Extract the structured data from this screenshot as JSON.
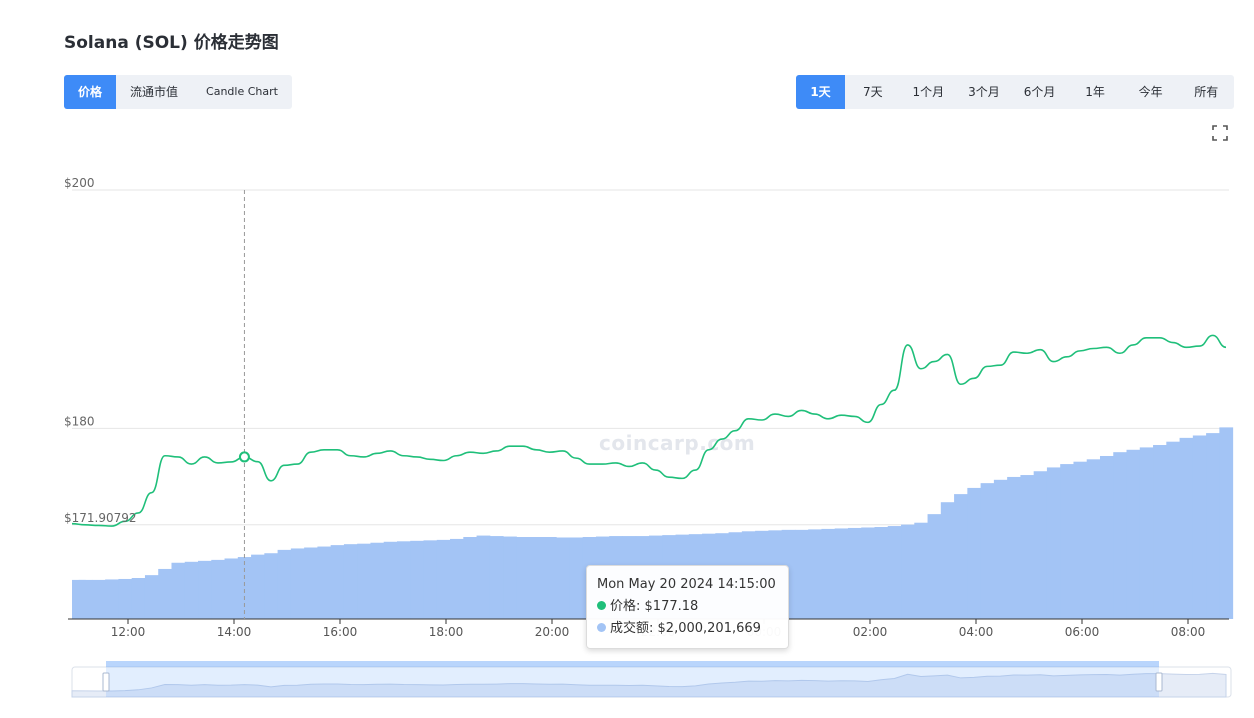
{
  "page_title": "Solana (SOL) 价格走势图",
  "metric_tabs": [
    {
      "label": "价格",
      "active": true
    },
    {
      "label": "流通市值",
      "active": false
    },
    {
      "label": "Candle Chart",
      "active": false
    }
  ],
  "range_tabs": [
    {
      "label": "1天",
      "active": true
    },
    {
      "label": "7天",
      "active": false
    },
    {
      "label": "1个月",
      "active": false
    },
    {
      "label": "3个月",
      "active": false
    },
    {
      "label": "6个月",
      "active": false
    },
    {
      "label": "1年",
      "active": false
    },
    {
      "label": "今年",
      "active": false
    },
    {
      "label": "所有",
      "active": false
    }
  ],
  "watermark": "coincarp.com",
  "tooltip": {
    "datetime": "Mon May 20 2024 14:15:00",
    "price_label": "价格:",
    "price_value": "$177.18",
    "volume_label": "成交额:",
    "volume_value": "$2,000,201,669"
  },
  "colors": {
    "price_line": "#1fbf7a",
    "volume_fill": "#a3c4f5",
    "accent": "#3e8bf7"
  },
  "chart_data": {
    "type": "line",
    "series": [
      {
        "name": "价格",
        "x": [
          "11:00",
          "11:15",
          "11:30",
          "11:45",
          "12:00",
          "12:15",
          "12:30",
          "12:45",
          "13:00",
          "13:15",
          "13:30",
          "13:45",
          "14:00",
          "14:15",
          "14:30",
          "14:45",
          "15:00",
          "15:15",
          "15:30",
          "15:45",
          "16:00",
          "16:15",
          "16:30",
          "16:45",
          "17:00",
          "17:15",
          "17:30",
          "17:45",
          "18:00",
          "18:15",
          "18:30",
          "18:45",
          "19:00",
          "19:15",
          "19:30",
          "19:45",
          "20:00",
          "20:15",
          "20:30",
          "20:45",
          "21:00",
          "21:15",
          "21:30",
          "21:45",
          "22:00",
          "22:15",
          "22:30",
          "22:45",
          "23:00",
          "23:15",
          "23:30",
          "23:45",
          "00:00",
          "00:15",
          "00:30",
          "00:45",
          "01:00",
          "01:15",
          "01:30",
          "01:45",
          "02:00",
          "02:15",
          "02:30",
          "02:45",
          "03:00",
          "03:15",
          "03:30",
          "03:45",
          "04:00",
          "04:15",
          "04:30",
          "04:45",
          "05:00",
          "05:15",
          "05:30",
          "05:45",
          "06:00",
          "06:15",
          "06:30",
          "06:45",
          "07:00",
          "07:15",
          "07:30",
          "07:45",
          "08:00",
          "08:15",
          "08:30",
          "08:45"
        ],
        "values": [
          172.0,
          171.9,
          171.85,
          171.8,
          172.2,
          172.9,
          174.6,
          177.7,
          177.6,
          177.0,
          177.6,
          177.1,
          177.18,
          177.6,
          177.2,
          175.6,
          176.9,
          177.0,
          178.0,
          178.2,
          178.2,
          177.7,
          177.6,
          177.9,
          178.1,
          177.7,
          177.6,
          177.4,
          177.3,
          177.7,
          178.0,
          177.9,
          178.1,
          178.5,
          178.5,
          178.2,
          178.0,
          178.1,
          177.5,
          177.0,
          177.0,
          177.1,
          176.8,
          177.1,
          176.5,
          175.9,
          175.8,
          176.5,
          178.2,
          179.1,
          179.8,
          180.8,
          180.7,
          181.2,
          181.0,
          181.5,
          181.2,
          180.8,
          181.1,
          181.0,
          180.5,
          182.0,
          183.2,
          187.0,
          185.0,
          185.6,
          186.2,
          183.7,
          184.2,
          185.2,
          185.3,
          186.4,
          186.3,
          186.6,
          185.6,
          186.0,
          186.5,
          186.7,
          186.8,
          186.3,
          187.0,
          187.6,
          187.6,
          187.2,
          186.8,
          186.9,
          187.8,
          186.8
        ]
      },
      {
        "name": "成交额",
        "values": [
          0.82,
          0.82,
          0.82,
          0.83,
          0.84,
          0.86,
          0.92,
          1.05,
          1.18,
          1.2,
          1.22,
          1.24,
          1.27,
          1.3,
          1.35,
          1.38,
          1.45,
          1.48,
          1.5,
          1.52,
          1.55,
          1.57,
          1.58,
          1.6,
          1.62,
          1.63,
          1.64,
          1.65,
          1.66,
          1.68,
          1.72,
          1.75,
          1.74,
          1.73,
          1.72,
          1.72,
          1.72,
          1.71,
          1.71,
          1.72,
          1.73,
          1.74,
          1.74,
          1.74,
          1.75,
          1.76,
          1.77,
          1.78,
          1.79,
          1.8,
          1.82,
          1.84,
          1.85,
          1.86,
          1.87,
          1.87,
          1.88,
          1.89,
          1.9,
          1.91,
          1.92,
          1.93,
          1.95,
          1.98,
          2.02,
          2.2,
          2.45,
          2.62,
          2.75,
          2.85,
          2.92,
          2.98,
          3.02,
          3.1,
          3.18,
          3.25,
          3.3,
          3.35,
          3.42,
          3.5,
          3.55,
          3.6,
          3.65,
          3.72,
          3.8,
          3.85,
          3.9,
          4.02
        ]
      }
    ],
    "y_ticks": [
      "$200",
      "$180",
      "$171.90792"
    ],
    "ylim": [
      164,
      200
    ],
    "x_ticks": [
      "12:00",
      "14:00",
      "16:00",
      "18:00",
      "20:00",
      "22:00",
      "00:00",
      "02:00",
      "04:00",
      "06:00",
      "08:00"
    ],
    "highlight_index": 13,
    "xlabel": "",
    "ylabel": "",
    "grid": true,
    "legend": "none"
  }
}
